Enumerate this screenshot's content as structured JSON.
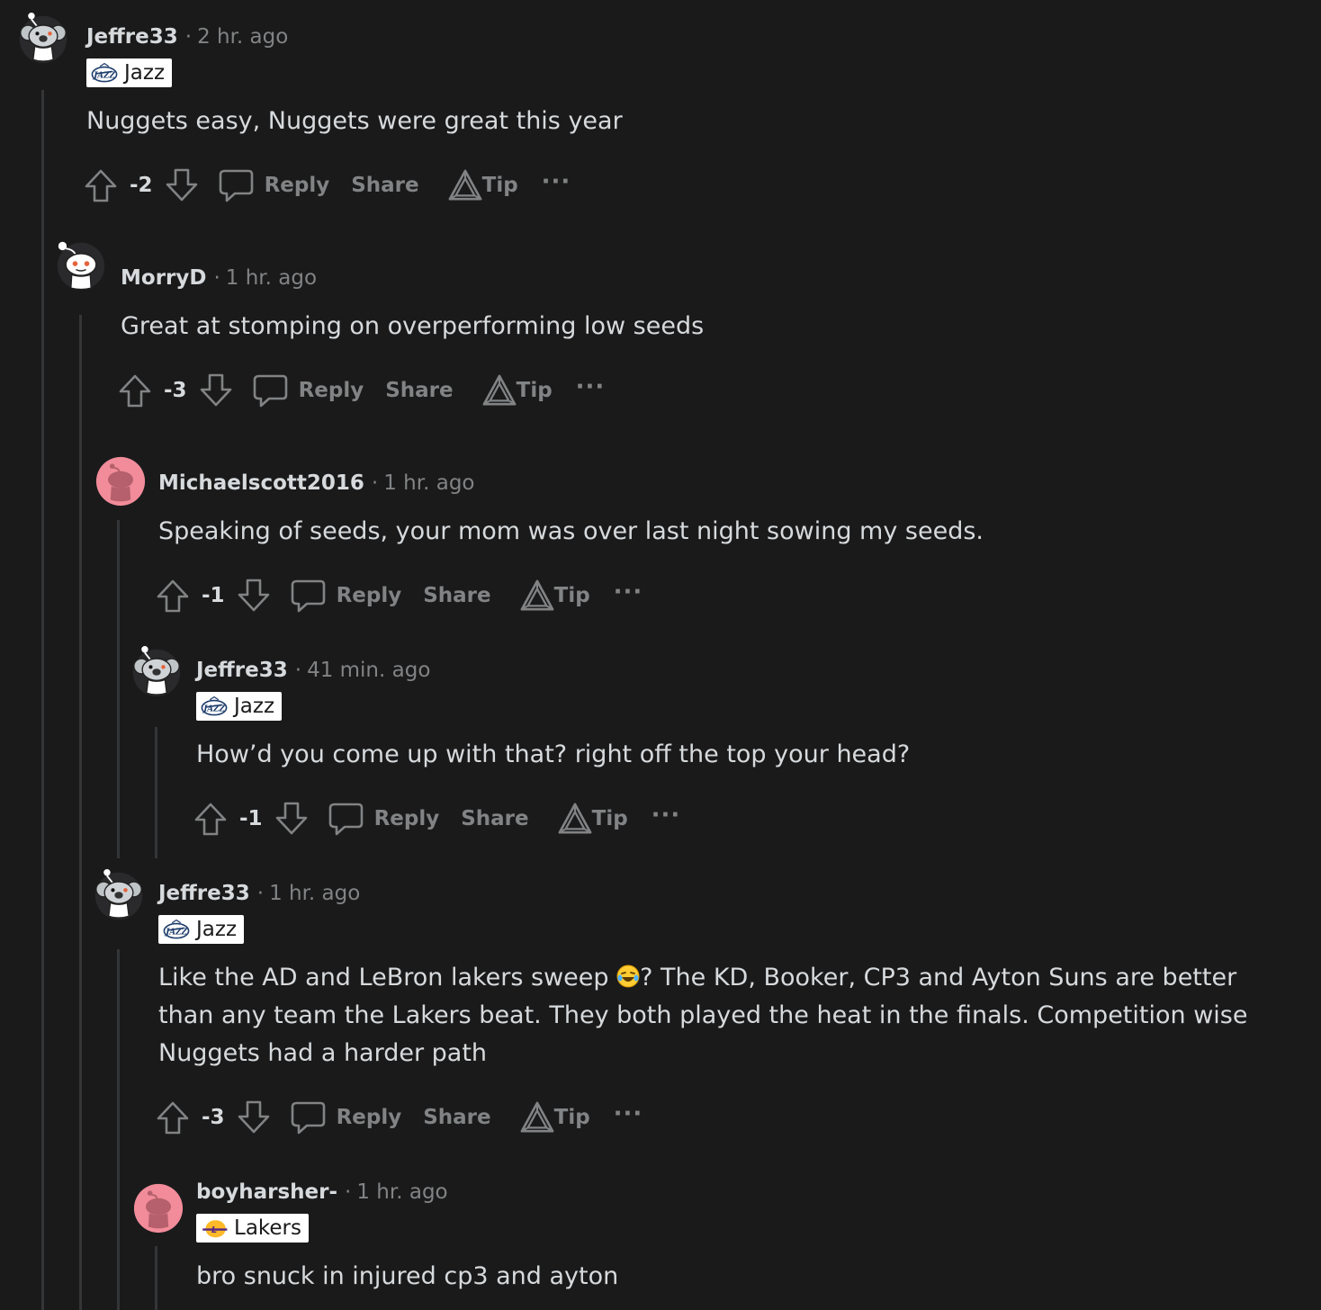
{
  "comments": [
    {
      "username": "Jeffre33",
      "time": "2 hr. ago",
      "avatar": "koala-avatar",
      "flair": {
        "team": "Jazz",
        "icon": "jazz-logo-icon"
      },
      "body": "Nuggets easy, Nuggets were great this year",
      "votes": "-2"
    },
    {
      "username": "MorryD",
      "time": "1 hr. ago",
      "avatar": "snoo-white-avatar",
      "flair": null,
      "body": "Great at stomping on overperforming low seeds",
      "votes": "-3"
    },
    {
      "username": "Michaelscott2016",
      "time": "1 hr. ago",
      "avatar": "snoo-pink-avatar",
      "flair": null,
      "body": "Speaking of seeds, your mom was over last night sowing my seeds.",
      "votes": "-1"
    },
    {
      "username": "Jeffre33",
      "time": "41 min. ago",
      "avatar": "koala-avatar",
      "flair": {
        "team": "Jazz",
        "icon": "jazz-logo-icon"
      },
      "body": "How’d you come up with that? right off the top your head?",
      "votes": "-1"
    },
    {
      "username": "Jeffre33",
      "time": "1 hr. ago",
      "avatar": "koala-avatar",
      "flair": {
        "team": "Jazz",
        "icon": "jazz-logo-icon"
      },
      "body_line1_before": "Like the AD and LeBron lakers sweep ",
      "body_line1_after": "? The KD, Booker, CP3 and Ayton Suns are better",
      "body_line2": "than any team the Lakers beat. They both played the heat in the finals. Competition wise",
      "body_line3": "Nuggets had a harder path",
      "emoji": "laughing-tears-emoji",
      "votes": "-3"
    },
    {
      "username": "boyharsher-",
      "time": "1 hr. ago",
      "avatar": "snoo-pink-avatar",
      "flair": {
        "team": "Lakers",
        "icon": "lakers-logo-icon"
      },
      "body": "bro snuck in injured cp3 and ayton"
    }
  ],
  "actions": {
    "reply": "Reply",
    "share": "Share",
    "tip": "Tip",
    "more": "···",
    "separator": "·"
  },
  "colors": {
    "background": "#1a1a1b",
    "text": "#d7dadc",
    "muted": "#818384",
    "thread_line": "#343536",
    "flair_bg": "#ffffff",
    "pink_avatar": "#f28c9a"
  }
}
